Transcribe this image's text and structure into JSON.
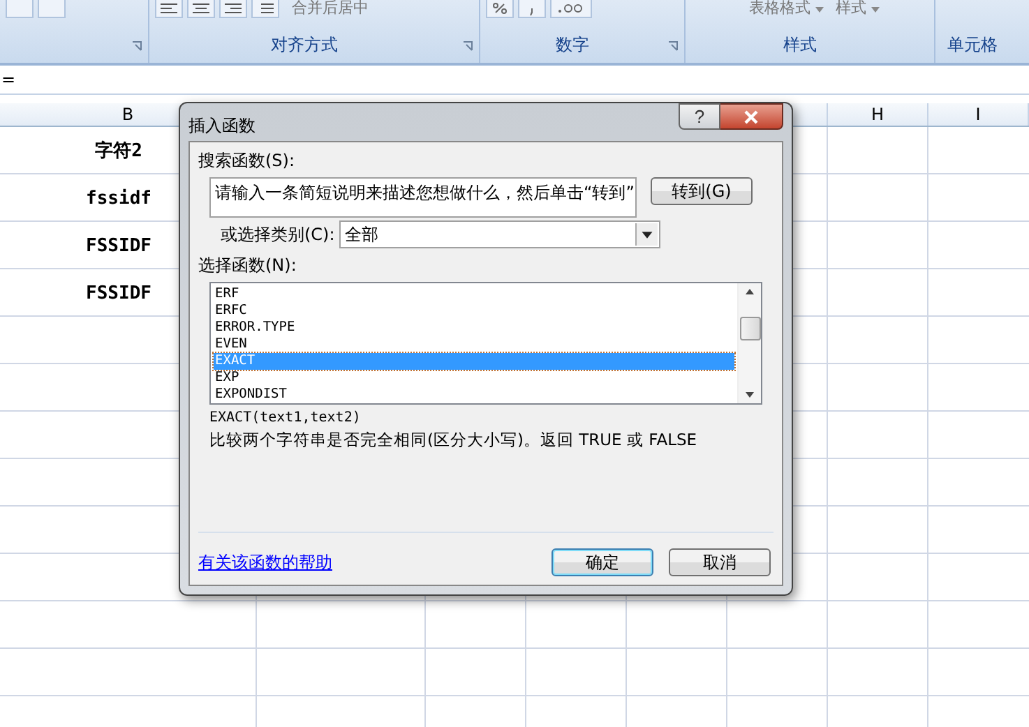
{
  "ribbon": {
    "top_labels": [
      "合并后居中",
      "表格格式",
      "样式"
    ],
    "groups": [
      {
        "label": "对齐方式"
      },
      {
        "label": "数字"
      },
      {
        "label": "样式"
      },
      {
        "label": "单元格"
      }
    ]
  },
  "formula_bar": {
    "content": "="
  },
  "sheet": {
    "column_headers": [
      "B",
      "H",
      "I"
    ],
    "column_b": [
      "字符2",
      "fssidf",
      "FSSIDF",
      "FSSIDF"
    ]
  },
  "dialog": {
    "title": "插入函数",
    "help_button": "?",
    "search_label": "搜索函数(S):",
    "search_value": "请输入一条简短说明来描述您想做什么，然后单击“转到”",
    "go_button": "转到(G)",
    "category_label": "或选择类别(C):",
    "category_value": "全部",
    "function_label": "选择函数(N):",
    "functions": [
      {
        "name": "ERF",
        "selected": false
      },
      {
        "name": "ERFC",
        "selected": false
      },
      {
        "name": "ERROR.TYPE",
        "selected": false
      },
      {
        "name": "EVEN",
        "selected": false
      },
      {
        "name": "EXACT",
        "selected": true
      },
      {
        "name": "EXP",
        "selected": false
      },
      {
        "name": "EXPONDIST",
        "selected": false
      }
    ],
    "signature": "EXACT(text1,text2)",
    "description": "比较两个字符串是否完全相同(区分大小写)。返回 TRUE 或 FALSE",
    "help_link": "有关该函数的帮助",
    "buttons": [
      {
        "label": "确定",
        "default": true
      },
      {
        "label": "取消",
        "default": false
      }
    ]
  }
}
